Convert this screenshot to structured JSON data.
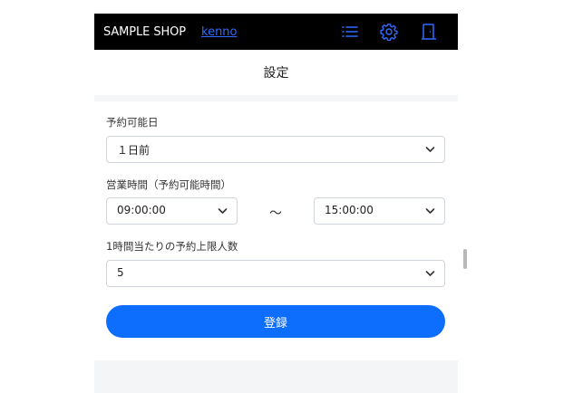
{
  "navbar": {
    "brand": "SAMPLE SHOP",
    "user_name": "kenno",
    "icons": [
      "list-icon",
      "gear-icon",
      "door-exit-icon"
    ],
    "background": "#000000",
    "accent": "#2f6bff"
  },
  "page": {
    "title": "設定"
  },
  "form": {
    "reservable_days": {
      "label": "予約可能日",
      "value": "１日前"
    },
    "business_hours": {
      "label": "営業時間（予約可能時間）",
      "start": "09:00:00",
      "separator": "～",
      "end": "15:00:00"
    },
    "hourly_limit": {
      "label": "1時間当たりの予約上限人数",
      "value": "5"
    },
    "submit_label": "登録",
    "submit_color": "#0d6efd"
  }
}
